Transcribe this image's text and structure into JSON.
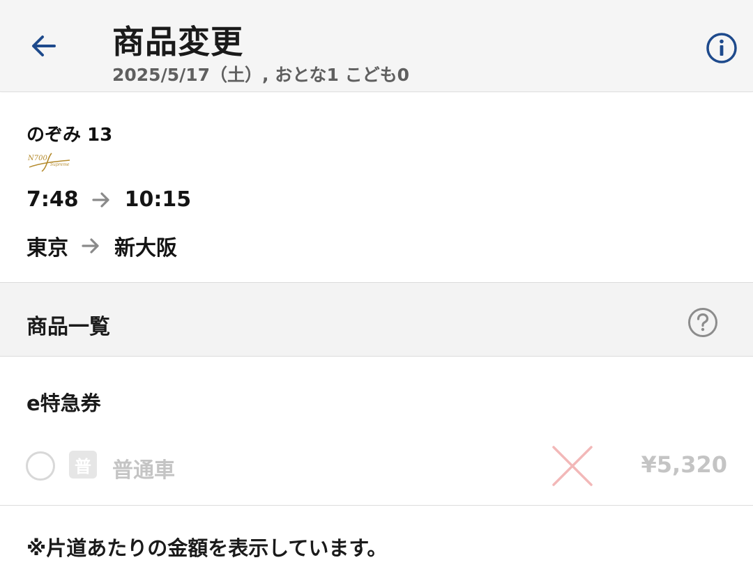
{
  "header": {
    "title": "商品変更",
    "subtitle": "2025/5/17（土）, おとな1 こども0",
    "accent_color": "#1e4a8c",
    "back_icon": "arrow-left-icon",
    "info_icon": "info-circle-icon"
  },
  "train": {
    "name": "のぞみ 13",
    "logo_text": "N700 Supreme",
    "depart_time": "7:48",
    "arrive_time": "10:15",
    "from_station": "東京",
    "to_station": "新大阪"
  },
  "product_list": {
    "title": "商品一覧",
    "help_icon": "question-circle-icon"
  },
  "ticket": {
    "type": "e特急券",
    "options": [
      {
        "badge": "普",
        "label": "普通車",
        "available": false,
        "price": "¥5,320",
        "selected": false
      }
    ],
    "unavailable_color": "#f2b8b8"
  },
  "footer": {
    "note": "※片道あたりの金額を表示しています。"
  }
}
